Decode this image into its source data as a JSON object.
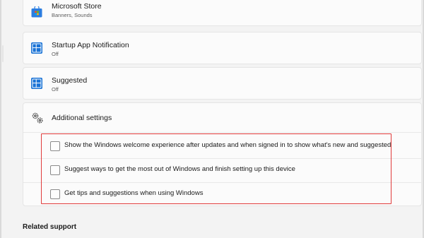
{
  "notifications": [
    {
      "name": "Microsoft Store",
      "status": "Banners, Sounds",
      "icon": "microsoft-store-icon"
    },
    {
      "name": "Startup App Notification",
      "status": "Off",
      "icon": "app-grid-icon"
    },
    {
      "name": "Suggested",
      "status": "Off",
      "icon": "app-grid-icon"
    }
  ],
  "additional": {
    "label": "Additional settings",
    "icon": "gear-pair-icon",
    "options": [
      {
        "label": "Show the Windows welcome experience after updates and when signed in to show what's new and suggested",
        "checked": false
      },
      {
        "label": "Suggest ways to get the most out of Windows and finish setting up this device",
        "checked": false
      },
      {
        "label": "Get tips and suggestions when using Windows",
        "checked": false
      }
    ]
  },
  "related_support": {
    "title": "Related support"
  },
  "colors": {
    "accent": "#0067c0",
    "highlight": "#e03a3a",
    "card": "#fbfbfb",
    "background": "#f3f3f3"
  }
}
